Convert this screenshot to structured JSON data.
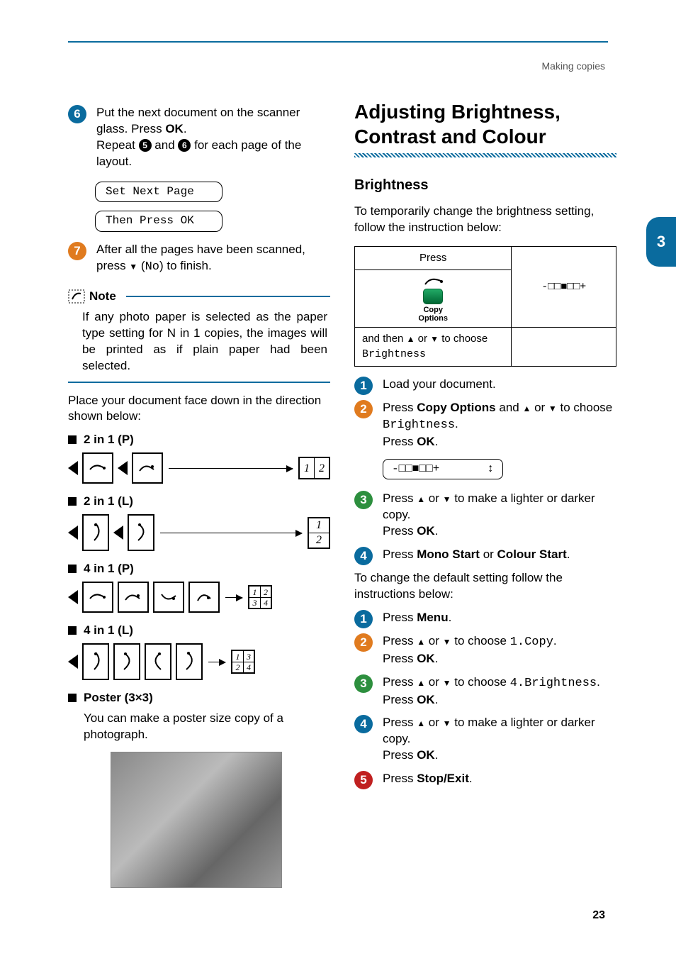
{
  "header": {
    "section": "Making copies"
  },
  "page_number": "23",
  "side_tab": "3",
  "left": {
    "step6": {
      "line1": "Put the next document on the scanner glass. Press ",
      "ok": "OK",
      "line2a": "Repeat ",
      "line2b": " and ",
      "line2c": " for each page of the layout.",
      "ref_a": "5",
      "ref_b": "6"
    },
    "lcd1": "Set Next Page",
    "lcd2": "Then Press OK",
    "step7": {
      "text_a": "After all the pages have been scanned, press ",
      "text_b": " (",
      "no": "No",
      "text_c": ") to finish."
    },
    "note_label": "Note",
    "note_body": "If any photo paper is selected as the paper type setting for N in 1 copies, the images will be printed as if plain paper had been selected.",
    "place_text": "Place your document face down in the direction shown below:",
    "b1": "2 in 1 (P)",
    "b2": "2 in 1 (L)",
    "b3": "4 in 1 (P)",
    "b4": "4 in 1 (L)",
    "b5": "Poster (3×3)",
    "b5_body": "You can make a poster size copy of a photograph.",
    "g": {
      "n1": "1",
      "n2": "2",
      "n3": "3",
      "n4": "4"
    }
  },
  "right": {
    "h1": "Adjusting Brightness, Contrast and Colour",
    "h2": "Brightness",
    "intro": "To temporarily change the brightness setting, follow the instruction below:",
    "press_hdr": "Press",
    "press_val": "-□□■□□+",
    "copy_label": "Copy\nOptions",
    "row2a": "and then ",
    "row2b": " or ",
    "row2c": " to choose ",
    "row2d": "Brightness",
    "steps_a": [
      {
        "num": "1",
        "color": "blue",
        "html": "Load your document."
      },
      {
        "num": "2",
        "color": "orange",
        "html": ""
      },
      {
        "num": "3",
        "color": "green",
        "html": ""
      },
      {
        "num": "4",
        "color": "blue",
        "html": ""
      }
    ],
    "s2_a": "Press ",
    "s2_b": "Copy Options",
    "s2_c": " and ",
    "s2_d": " or ",
    "s2_e": " to choose ",
    "s2_f": "Brightness",
    "s2_g": "Press ",
    "s2_ok": "OK",
    "lcd3": "-□□■□□+       ↕",
    "s3_a": "Press ",
    "s3_b": " or ",
    "s3_c": " to make a lighter or darker copy.",
    "s3_d": "Press ",
    "s3_ok": "OK",
    "s4_a": "Press ",
    "s4_b": "Mono Start",
    "s4_c": " or ",
    "s4_d": "Colour Start",
    "mid": "To change the default setting follow the instructions below:",
    "steps_b": [
      {
        "num": "1",
        "color": "blue"
      },
      {
        "num": "2",
        "color": "orange"
      },
      {
        "num": "3",
        "color": "green"
      },
      {
        "num": "4",
        "color": "blue"
      },
      {
        "num": "5",
        "color": "red"
      }
    ],
    "b1_a": "Press ",
    "b1_b": "Menu",
    "b2_a": "Press ",
    "b2_b": " or ",
    "b2_c": " to choose ",
    "b2_d": "1.Copy",
    "b2_e": "Press ",
    "b2_ok": "OK",
    "b3_a": "Press ",
    "b3_b": " or ",
    "b3_c": " to choose ",
    "b3_d": "4.Brightness",
    "b3_e": "Press ",
    "b3_ok": "OK",
    "b4_a": "Press ",
    "b4_b": " or ",
    "b4_c": " to make a lighter or darker copy.",
    "b4_d": "Press ",
    "b4_ok": "OK",
    "b5_a": "Press ",
    "b5_b": "Stop/Exit"
  }
}
